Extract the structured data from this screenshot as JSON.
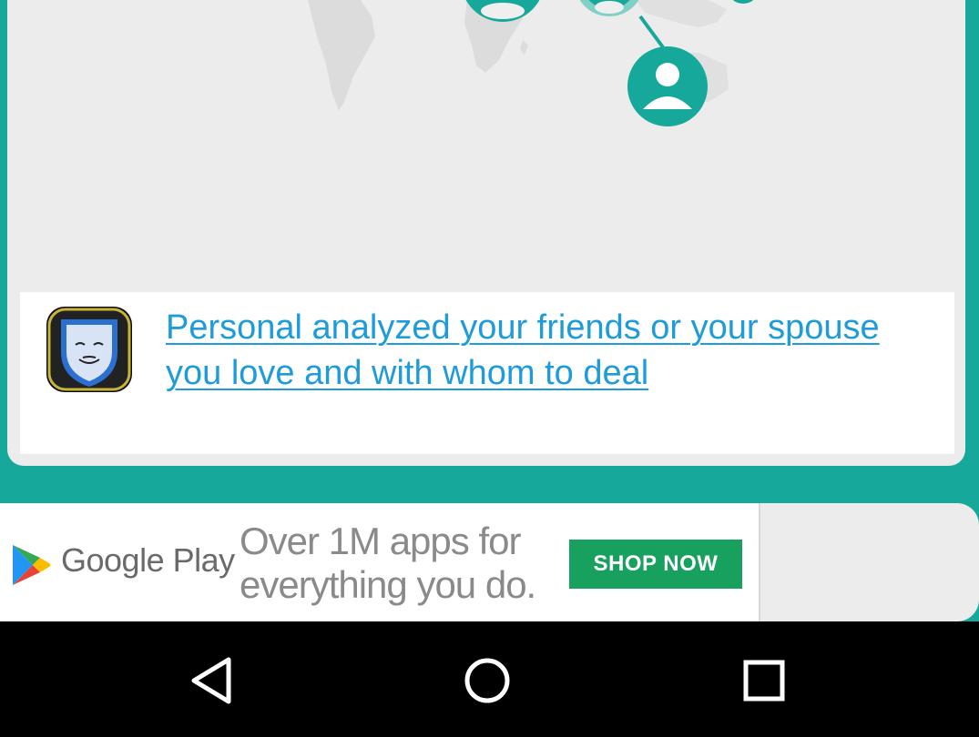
{
  "colors": {
    "background": "#16A89A",
    "card": "#ECECEC",
    "link": "#1E9BDA",
    "shop_button": "#17A05E",
    "nav_bar": "#000000"
  },
  "card": {
    "link_text": "Personal analyzed your friends or your spouse you love and with whom to deal",
    "icons": [
      "world-map",
      "person-avatar-icon",
      "app-icon"
    ]
  },
  "ad": {
    "brand": "Google Play",
    "tagline": "Over 1M apps for everything you do.",
    "cta": "SHOP NOW",
    "icons": [
      "google-play-logo-icon"
    ]
  },
  "nav": {
    "buttons": [
      {
        "name": "back",
        "icon": "triangle-back-icon"
      },
      {
        "name": "home",
        "icon": "circle-home-icon"
      },
      {
        "name": "recents",
        "icon": "square-recents-icon"
      }
    ]
  }
}
